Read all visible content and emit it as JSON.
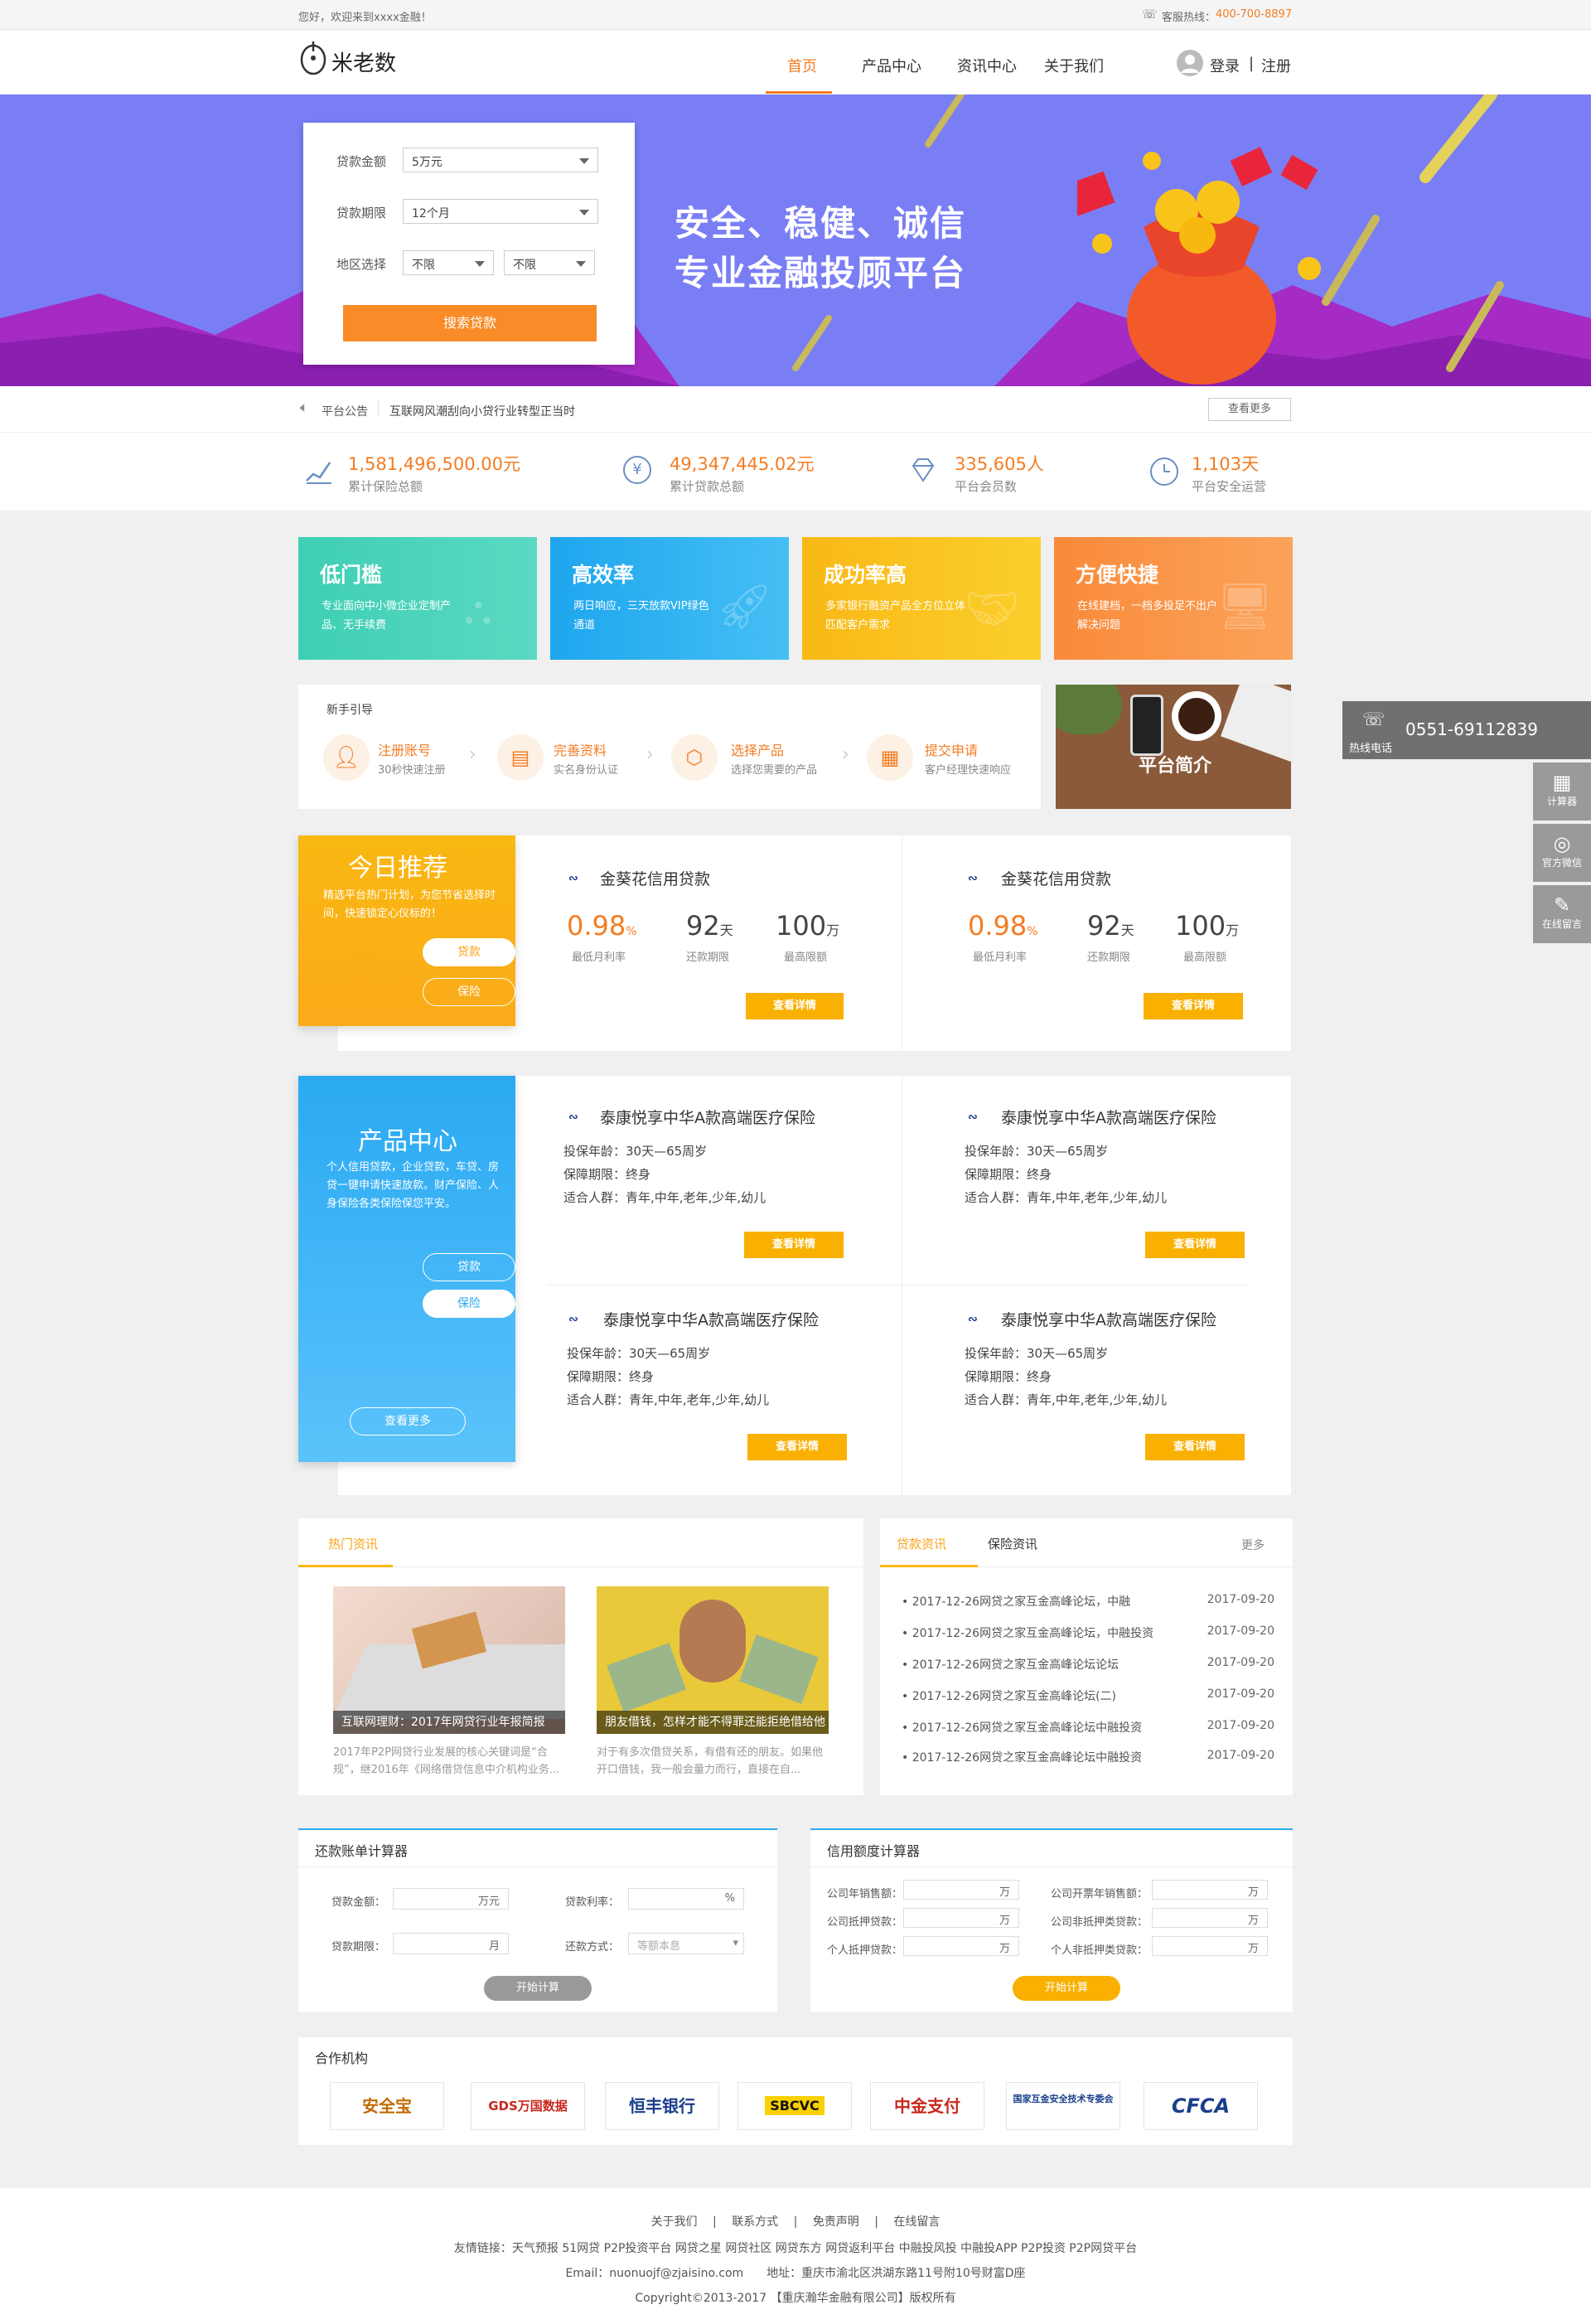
{
  "topbar": {
    "welcome": "您好，欢迎来到xxxx金融！",
    "hotline_label": "客服热线：",
    "hotline": "400-700-8897"
  },
  "header": {
    "logo_text": "米老数",
    "nav": [
      "首页",
      "产品中心",
      "资讯中心",
      "关于我们"
    ],
    "login": "登录",
    "sep": "|",
    "register": "注册"
  },
  "banner": {
    "form": {
      "amount_label": "贷款金额",
      "amount_value": "5万元",
      "term_label": "贷款期限",
      "term_value": "12个月",
      "region_label": "地区选择",
      "region_a": "不限",
      "region_b": "不限",
      "search_button": "搜索贷款"
    },
    "slogan1": "安全、稳健、诚信",
    "slogan2": "专业金融投顾平台"
  },
  "notice": {
    "label": "平台公告",
    "text": "互联网风潮刮向小贷行业转型正当时",
    "more": "查看更多"
  },
  "stats": [
    {
      "value": "1,581,496,500.00元",
      "label": "累计保险总额",
      "icon": "chart-icon"
    },
    {
      "value": "49,347,445.02元",
      "label": "累计贷款总额",
      "icon": "yen-icon"
    },
    {
      "value": "335,605人",
      "label": "平台会员数",
      "icon": "diamond-icon"
    },
    {
      "value": "1,103天",
      "label": "平台安全运营",
      "icon": "clock-icon"
    }
  ],
  "features": [
    {
      "title": "低门槛",
      "desc": "专业面向中小微企业定制产品、无手续费",
      "color": "#47d1b8"
    },
    {
      "title": "高效率",
      "desc": "两日响应，三天放款VIP绿色通道",
      "color": "#2ab0ef"
    },
    {
      "title": "成功率高",
      "desc": "多家银行融资产品全方位立体匹配客户需求",
      "color": "#fbc21d"
    },
    {
      "title": "方便快捷",
      "desc": "在线建档，一档多投足不出户解决问题",
      "color": "#f98b3e"
    }
  ],
  "guide": {
    "title": "新手引导",
    "steps": [
      {
        "title": "注册账号",
        "desc": "30秒快速注册"
      },
      {
        "title": "完善资料",
        "desc": "实名身份认证"
      },
      {
        "title": "选择产品",
        "desc": "选择您需要的产品"
      },
      {
        "title": "提交申请",
        "desc": "客户经理快速响应"
      }
    ],
    "intro": "平台简介"
  },
  "recommend": {
    "title": "今日推荐",
    "desc": "精选平台热门计划，为您节省选择时间，快速锁定心仪标的！",
    "btn_loan": "贷款",
    "btn_ins": "保险",
    "items": [
      {
        "name": "金葵花信用贷款",
        "rate": "0.98",
        "rate_unit": "%",
        "rate_label": "最低月利率",
        "term": "92",
        "term_unit": "天",
        "term_label": "还款期限",
        "limit": "100",
        "limit_unit": "万",
        "limit_label": "最高限额",
        "btn": "查看详情"
      },
      {
        "name": "金葵花信用贷款",
        "rate": "0.98",
        "rate_unit": "%",
        "rate_label": "最低月利率",
        "term": "92",
        "term_unit": "天",
        "term_label": "还款期限",
        "limit": "100",
        "limit_unit": "万",
        "limit_label": "最高限额",
        "btn": "查看详情"
      }
    ]
  },
  "products": {
    "title": "产品中心",
    "desc": "个人信用贷款，企业贷款，车贷、房贷一键申请快速放款。财产保险、人身保险各类保险保您平安。",
    "btn_loan": "贷款",
    "btn_ins": "保险",
    "more": "查看更多",
    "items": [
      {
        "name": "泰康悦享中华A款高端医疗保险",
        "age": "投保年龄：30天—65周岁",
        "period": "保障期限：终身",
        "people": "适合人群：青年,中年,老年,少年,幼儿",
        "btn": "查看详情"
      },
      {
        "name": "泰康悦享中华A款高端医疗保险",
        "age": "投保年龄：30天—65周岁",
        "period": "保障期限：终身",
        "people": "适合人群：青年,中年,老年,少年,幼儿",
        "btn": "查看详情"
      },
      {
        "name": "泰康悦享中华A款高端医疗保险",
        "age": "投保年龄：30天—65周岁",
        "period": "保障期限：终身",
        "people": "适合人群：青年,中年,老年,少年,幼儿",
        "btn": "查看详情"
      },
      {
        "name": "泰康悦享中华A款高端医疗保险",
        "age": "投保年龄：30天—65周岁",
        "period": "保障期限：终身",
        "people": "适合人群：青年,中年,老年,少年,幼儿",
        "btn": "查看详情"
      }
    ]
  },
  "hotnews": {
    "tab": "热门资讯",
    "items": [
      {
        "caption": "互联网理财：2017年网贷行业年报简报",
        "summary": "2017年P2P网贷行业发展的核心关键词是“合规”，继2016年《网络借贷信息中介机构业务..."
      },
      {
        "caption": "朋友借钱，怎样才能不得罪还能拒绝借给他",
        "summary": "对于有多次借贷关系，有借有还的朋友。如果他开口借钱，我一般会量力而行，直接在自..."
      }
    ]
  },
  "newslist": {
    "tab_active": "贷款资讯",
    "tab_other": "保险资讯",
    "more": "更多",
    "items": [
      {
        "title": "2017-12-26网贷之家互金高峰论坛，中融",
        "date": "2017-09-20"
      },
      {
        "title": "2017-12-26网贷之家互金高峰论坛，中融投资",
        "date": "2017-09-20"
      },
      {
        "title": "2017-12-26网贷之家互金高峰论坛论坛",
        "date": "2017-09-20"
      },
      {
        "title": "2017-12-26网贷之家互金高峰论坛(二)",
        "date": "2017-09-20"
      },
      {
        "title": "2017-12-26网贷之家互金高峰论坛中融投资",
        "date": "2017-09-20"
      },
      {
        "title": "2017-12-26网贷之家互金高峰论坛中融投资",
        "date": "2017-09-20"
      }
    ]
  },
  "calc1": {
    "title": "还款账单计算器",
    "amount_label": "贷款金额：",
    "amount_unit": "万元",
    "rate_label": "贷款利率：",
    "rate_unit": "%",
    "term_label": "贷款期限：",
    "term_unit": "月",
    "method_label": "还款方式：",
    "method_value": "等额本息",
    "btn": "开始计算"
  },
  "calc2": {
    "title": "信用额度计算器",
    "rows": [
      {
        "l1": "公司年销售额：",
        "u1": "万",
        "l2": "公司开票年销售额：",
        "u2": "万"
      },
      {
        "l1": "公司抵押贷款：",
        "u1": "万",
        "l2": "公司非抵押类贷款：",
        "u2": "万"
      },
      {
        "l1": "个人抵押贷款：",
        "u1": "万",
        "l2": "个人非抵押类贷款：",
        "u2": "万"
      }
    ],
    "btn": "开始计算"
  },
  "partners": {
    "title": "合作机构",
    "items": [
      "安全宝",
      "GDS万国数据",
      "恒丰银行",
      "SBCVC",
      "中金支付",
      "国家互金安全技术专委会",
      "CFCA"
    ]
  },
  "sidebar": {
    "phone": "0551-69112839",
    "phone_label": "热线电话",
    "calc": "计算器",
    "wechat": "官方微信",
    "message": "在线留言"
  },
  "footer": {
    "links": [
      "关于我们",
      "联系方式",
      "免责声明",
      "在线留言"
    ],
    "friend_links": "友情链接：天气预报 51网贷 P2P投资平台 网贷之星 网贷社区 网贷东方 网贷返利平台 中融投风投 中融投APP P2P投资 P2P网贷平台",
    "contact": "Email：nuonuojf@zjaisino.com　　地址：重庆市渝北区洪湖东路11号附10号财富D座",
    "copyright": "Copyright©2013-2017 【重庆瀚华金融有限公司】版权所有"
  }
}
